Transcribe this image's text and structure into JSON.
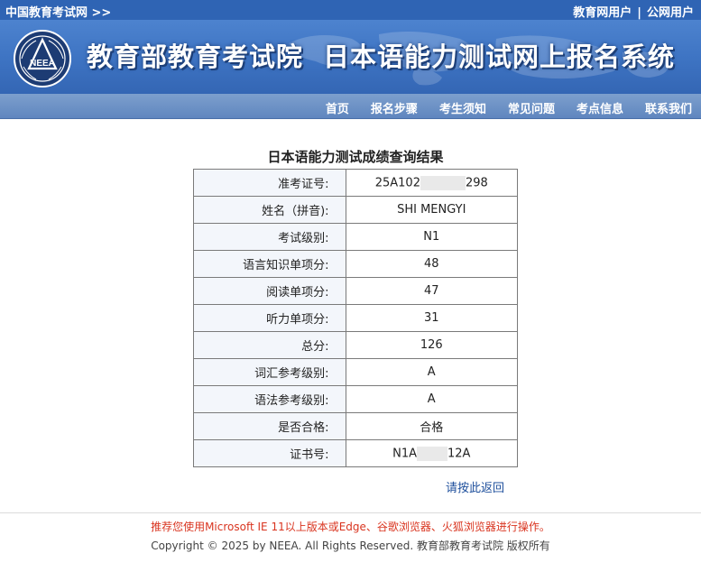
{
  "topbar": {
    "site_link": "中国教育考试网 >>",
    "user_links": [
      "教育网用户",
      "公网用户"
    ],
    "separator": "|"
  },
  "banner": {
    "org_name": "教育部教育考试院",
    "system_name": "日本语能力测试网上报名系统",
    "logo_text": "NEEA"
  },
  "nav": {
    "items": [
      "首页",
      "报名步骤",
      "考生须知",
      "常见问题",
      "考点信息",
      "联系我们"
    ]
  },
  "result": {
    "title": "日本语能力测试成绩查询结果",
    "rows": [
      {
        "label": "准考证号:",
        "value_prefix": "25A102",
        "value_suffix": "298",
        "masked": true
      },
      {
        "label": "姓名（拼音):",
        "value": "SHI MENGYI"
      },
      {
        "label": "考试级别:",
        "value": "N1"
      },
      {
        "label": "语言知识单项分:",
        "value": "48"
      },
      {
        "label": "阅读单项分:",
        "value": "47"
      },
      {
        "label": "听力单项分:",
        "value": "31"
      },
      {
        "label": "总分:",
        "value": "126"
      },
      {
        "label": "词汇参考级别:",
        "value": "A"
      },
      {
        "label": "语法参考级别:",
        "value": "A"
      },
      {
        "label": "是否合格:",
        "value": "合格"
      },
      {
        "label": "证书号:",
        "value_prefix": "N1A",
        "value_suffix": "12A",
        "masked": true
      }
    ],
    "back_link": "请按此返回"
  },
  "footer": {
    "browser_tip": "推荐您使用Microsoft IE 11以上版本或Edge、谷歌浏览器、火狐浏览器进行操作。",
    "copyright": "Copyright © 2025 by NEEA. All Rights Reserved. 教育部教育考试院 版权所有"
  },
  "colors": {
    "topbar": "#2f64b4",
    "banner": "#4d83cf",
    "nav": "#6d93c6",
    "tip_red": "#d9341f",
    "link_blue": "#1e4f9c"
  }
}
